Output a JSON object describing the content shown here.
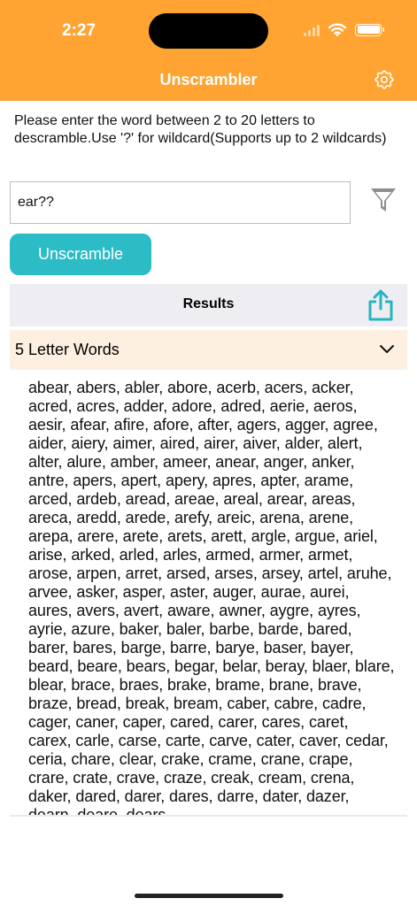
{
  "status_bar": {
    "time": "2:27"
  },
  "nav": {
    "title": "Unscrambler",
    "settings_icon": "gear-icon"
  },
  "instructions": "Please enter the word between 2 to 20 letters to descramble.Use '?' for wildcard(Supports up to 2 wildcards)",
  "search": {
    "value": "ear??",
    "filter_icon": "filter-icon"
  },
  "unscramble_label": "Unscramble",
  "results": {
    "title": "Results",
    "share_icon": "share-icon"
  },
  "section": {
    "title": "5 Letter Words",
    "chevron_icon": "chevron-down-icon"
  },
  "words_text": "abear, abers, abler, abore, acerb, acers, acker, acred, acres, adder, adore, adred, aerie, aeros, aesir, afear, afire, afore, after, agers, agger, agree, aider, aiery, aimer, aired, airer, aiver, alder, alert, alter, alure, amber, ameer, anear, anger, anker, antre, apers, apert, apery, apres, apter, arame, arced, ardeb, aread, areae, areal, arear, areas, areca, aredd, arede, arefy, areic, arena, arene, arepa, arere, arete, arets, arett, argle, argue, ariel, arise, arked, arled, arles, armed, armer, armet, arose, arpen, arret, arsed, arses, arsey, artel, aruhe, arvee, asker, asper, aster, auger, aurae, aurei, aures, avers, avert, aware, awner, aygre, ayres, ayrie, azure, baker, baler, barbe, barde, bared, barer, bares, barge, barre, barye, baser, bayer, beard, beare, bears, begar, belar, beray, blaer, blare, blear, brace, braes, brake, brame, brane, brave, braze, bread, break, bream, caber, cabre, cadre, cager, caner, caper, cared, carer, cares, caret, carex, carle, carse, carte, carve, cater, caver, cedar, ceria, chare, clear, crake, crame, crane, crape, crare, crate, crave, craze, creak, cream, crena, daker, dared, darer, dares, darre, dater, dazer, dearn, deare, dears"
}
